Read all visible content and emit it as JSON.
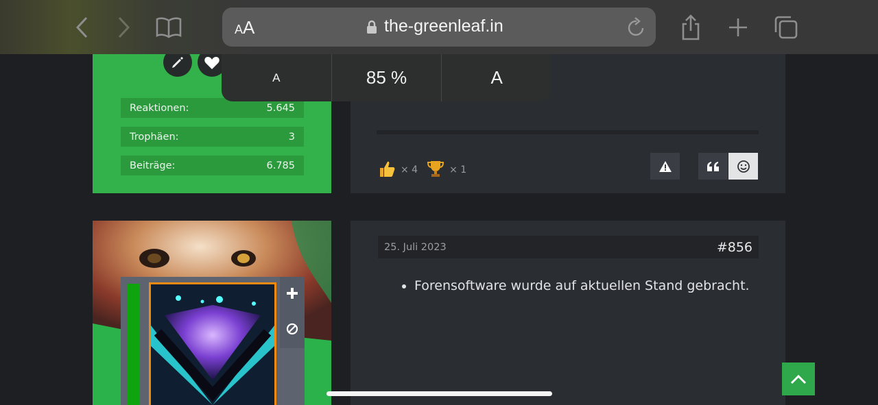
{
  "browser": {
    "text_size_label_small": "A",
    "text_size_label_large": "A",
    "url": "the-greenleaf.in"
  },
  "zoom_popover": {
    "decrease_label": "A",
    "zoom_level": "85 %",
    "increase_label": "A"
  },
  "profile_stats": [
    {
      "label": "Reaktionen:",
      "value": "5.645"
    },
    {
      "label": "Trophäen:",
      "value": "3"
    },
    {
      "label": "Beiträge:",
      "value": "6.785"
    }
  ],
  "reactions": [
    {
      "icon": "thumbs-up-icon",
      "count": "× 4"
    },
    {
      "icon": "trophy-icon",
      "count": "× 1"
    }
  ],
  "post": {
    "date": "25. Juli 2023",
    "number": "#856",
    "bullet": "Forensoftware wurde auf aktuellen Stand gebracht."
  },
  "colors": {
    "accent_green": "#33b14a",
    "panel_dark": "#2a2d31",
    "background": "#1e1f22"
  }
}
